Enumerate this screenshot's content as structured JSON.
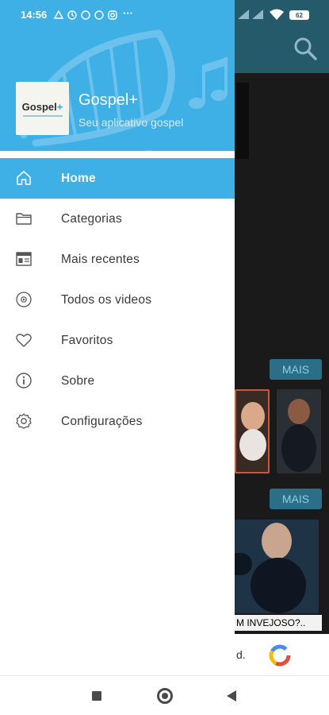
{
  "status_bar": {
    "time": "14:56",
    "notification_icons": [
      "app-notification-icon",
      "alarm-icon",
      "whatsapp-icon",
      "messenger-icon",
      "instagram-icon"
    ],
    "overflow": "···",
    "battery": "62"
  },
  "drawer": {
    "app_title": "Gospel+",
    "app_subtitle": "Seu aplicativo gospel",
    "logo_text": "Gospel",
    "logo_plus": "+",
    "menu": [
      {
        "label": "Home",
        "icon": "home-icon",
        "active": true
      },
      {
        "label": "Categorias",
        "icon": "folder-icon",
        "active": false
      },
      {
        "label": "Mais recentes",
        "icon": "calendar-icon",
        "active": false
      },
      {
        "label": "Todos os videos",
        "icon": "video-disc-icon",
        "active": false
      },
      {
        "label": "Favoritos",
        "icon": "heart-icon",
        "active": false
      },
      {
        "label": "Sobre",
        "icon": "info-icon",
        "active": false
      },
      {
        "label": "Configurações",
        "icon": "gear-icon",
        "active": false
      }
    ]
  },
  "background_app": {
    "more_button_1": "MAIS",
    "more_button_2": "MAIS",
    "video_caption": "M INVEJOSO?..",
    "ad_text": "d."
  },
  "colors": {
    "accent": "#3eb0e6",
    "app_bar": "#255a6b"
  }
}
